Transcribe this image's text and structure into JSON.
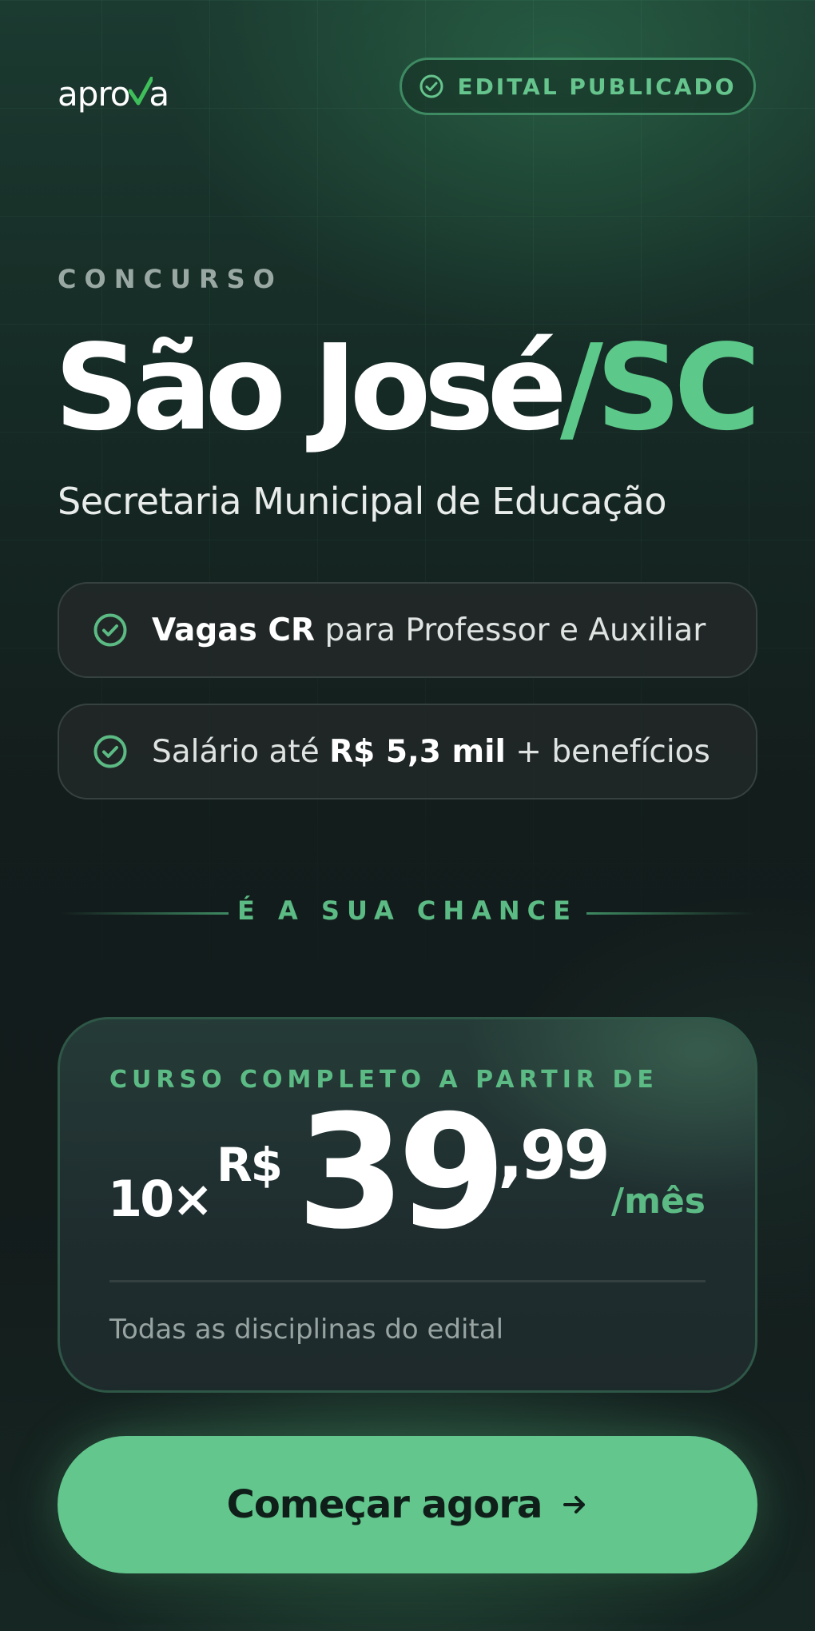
{
  "header": {
    "logo": {
      "prefix": "apro",
      "check_letter": "v",
      "suffix": "a"
    },
    "badge": {
      "label": "EDITAL PUBLICADO",
      "icon": "check-circle-icon"
    }
  },
  "hero": {
    "eyebrow": "CONCURSO",
    "title_main": "São José",
    "title_accent": "/SC",
    "subtitle": "Secretaria Municipal de Educação"
  },
  "features": [
    {
      "icon": "check-circle-icon",
      "strong": "Vagas CR",
      "text": " para Professor e Auxiliar"
    },
    {
      "icon": "check-circle-icon",
      "text_before": "Salário até ",
      "strong": "R$ 5,3 mil",
      "text_after": " + benefícios"
    }
  ],
  "divider": {
    "label": "É A SUA CHANCE"
  },
  "price_card": {
    "eyebrow": "CURSO COMPLETO A PARTIR DE",
    "installments": "10×",
    "currency": "R$",
    "amount_integer": "39",
    "amount_cents": ",99",
    "period": "/mês",
    "note": "Todas as disciplinas do edital"
  },
  "cta": {
    "label": "Começar agora",
    "icon": "arrow-right-icon"
  },
  "colors": {
    "accent": "#5cc88a",
    "cta_background": "#62c68d",
    "background": "#131c1b",
    "muted_text": "#9aa8a3"
  }
}
